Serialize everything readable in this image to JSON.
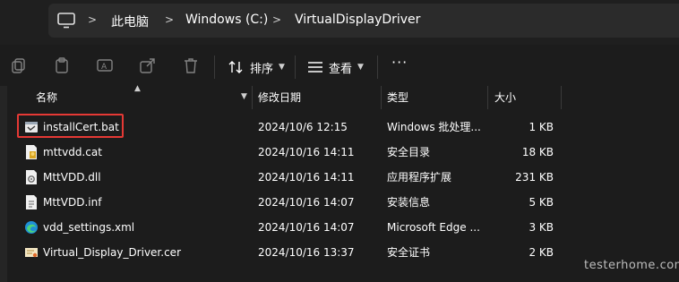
{
  "address": {
    "crumbs": [
      "此电脑",
      "Windows (C:)",
      "VirtualDisplayDriver"
    ]
  },
  "toolbar": {
    "sort_label": "排序",
    "view_label": "查看",
    "more_label": "···"
  },
  "columns": {
    "name": "名称",
    "date": "修改日期",
    "type": "类型",
    "size": "大小"
  },
  "files": [
    {
      "name": "installCert.bat",
      "date": "2024/10/6 12:15",
      "type": "Windows 批处理...",
      "size": "1 KB",
      "icon": "batch-file-icon"
    },
    {
      "name": "mttvdd.cat",
      "date": "2024/10/16 14:11",
      "type": "安全目录",
      "size": "18 KB",
      "icon": "security-catalog-icon"
    },
    {
      "name": "MttVDD.dll",
      "date": "2024/10/16 14:11",
      "type": "应用程序扩展",
      "size": "231 KB",
      "icon": "dll-file-icon"
    },
    {
      "name": "MttVDD.inf",
      "date": "2024/10/16 14:07",
      "type": "安装信息",
      "size": "5 KB",
      "icon": "inf-file-icon"
    },
    {
      "name": "vdd_settings.xml",
      "date": "2024/10/16 14:07",
      "type": "Microsoft Edge ...",
      "size": "3 KB",
      "icon": "edge-xml-icon"
    },
    {
      "name": "Virtual_Display_Driver.cer",
      "date": "2024/10/16 13:37",
      "type": "安全证书",
      "size": "2 KB",
      "icon": "certificate-icon"
    }
  ],
  "watermark": "testerhome.com",
  "colors": {
    "highlight": "#e53935",
    "background": "#1c1c1c"
  }
}
